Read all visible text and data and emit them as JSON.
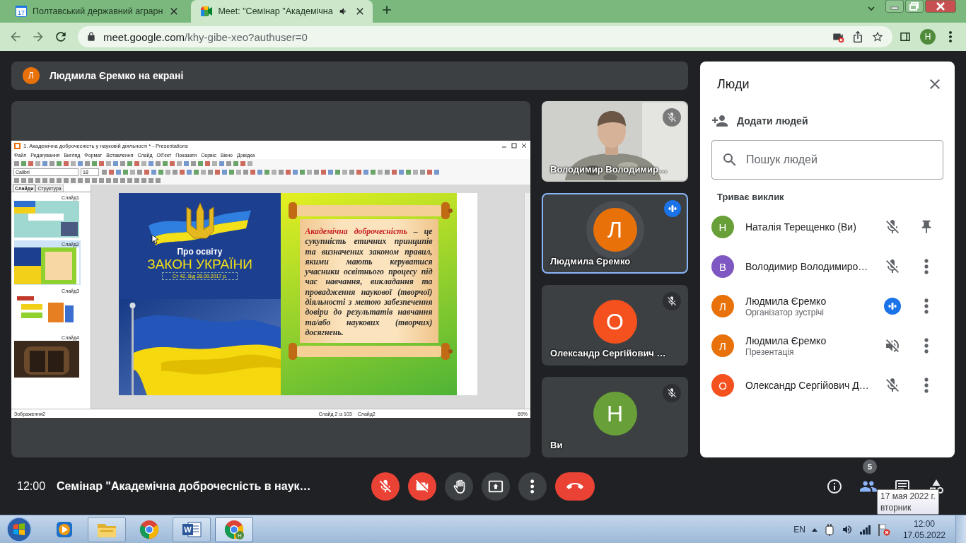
{
  "browser": {
    "tabs": [
      {
        "title": "Полтавський державний аграрн",
        "kind": "calendar",
        "icon_text": "17",
        "selected": false,
        "audio": false
      },
      {
        "title": "Meet: \"Семінар \"Академічна",
        "kind": "meet",
        "selected": true,
        "audio": true
      }
    ],
    "address": {
      "host": "meet.google.com",
      "path": "/khy-gibe-xeo?authuser=0"
    },
    "profile_initial": "Н"
  },
  "presenter_banner": {
    "initial": "Л",
    "text": "Людмила Єремко на екрані"
  },
  "shared_screen": {
    "window_title": "1. Академічна доброчесність у науковій діяльності * - Presentations",
    "menu": [
      "Файл",
      "Редагування",
      "Вигляд",
      "Формат",
      "Вставлення",
      "Слайд",
      "Об'єкт",
      "Показати",
      "Сервіс",
      "Вікно",
      "Довідка"
    ],
    "font_name": "Calibri",
    "font_size": "18",
    "panel_tabs": [
      {
        "label": "Слайди",
        "selected": true
      },
      {
        "label": "Структура",
        "selected": false
      }
    ],
    "thumbnails": [
      {
        "label": "Слайд1",
        "selected": false
      },
      {
        "label": "Слайд2",
        "selected": true
      },
      {
        "label": "Слайд3",
        "selected": false
      },
      {
        "label": "Слайд4",
        "selected": false
      }
    ],
    "slide": {
      "subtitle": "Про освіту",
      "title": "ЗАКОН УКРАЇНИ",
      "caption": "Ст 42. Від 28.09.2017 р.",
      "definition": "**Академічна доброчесність** – це сукупність етичних принципів та визначених законом правил, якими мають керуватися учасники освітнього процесу під час навчання, викладання та провадження наукової (творчої) діяльності з метою забезпечення довіри до результатів навчання та/або наукових (творчих) досягнень."
    },
    "status": {
      "object": "Зображення2",
      "position": "Слайд 2 із 103",
      "slide_name": "Слайд2",
      "zoom": "69%"
    }
  },
  "tiles": [
    {
      "kind": "video",
      "name": "Володимир Володимир…",
      "muted": true,
      "speaking": false
    },
    {
      "kind": "avatar",
      "initial": "Л",
      "color": "#e8710a",
      "name": "Людмила Єремко",
      "muted": false,
      "speaking": true
    },
    {
      "kind": "avatar",
      "initial": "О",
      "color": "#f4511e",
      "name": "Олександр Сергійович …",
      "muted": true,
      "speaking": false
    },
    {
      "kind": "avatar",
      "initial": "Н",
      "color": "#689f38",
      "name": "Ви",
      "muted": true,
      "speaking": false
    }
  ],
  "people": {
    "title": "Люди",
    "add_label": "Додати людей",
    "search_placeholder": "Пошук людей",
    "section": "Триває виклик",
    "participants": [
      {
        "kind": "self",
        "initial": "Н",
        "color": "#689f38",
        "name": "Наталія Терещенко (Ви)",
        "muted": true,
        "speaking": false,
        "sound_off": false
      },
      {
        "kind": "other",
        "initial": "В",
        "color": "#7e57c2",
        "name": "Володимир Володимиро…",
        "muted": true,
        "speaking": false,
        "sound_off": false
      },
      {
        "kind": "other",
        "initial": "Л",
        "color": "#e8710a",
        "name": "Людмила Єремко",
        "role": "Організатор зустрічі",
        "muted": false,
        "speaking": true,
        "sound_off": false
      },
      {
        "kind": "other",
        "initial": "Л",
        "color": "#e8710a",
        "name": "Людмила Єремко",
        "role": "Презентація",
        "muted": false,
        "speaking": false,
        "sound_off": true
      },
      {
        "kind": "other",
        "initial": "О",
        "color": "#f4511e",
        "name": "Олександр Сергійович Д…",
        "muted": true,
        "speaking": false,
        "sound_off": false
      }
    ]
  },
  "controls": {
    "time": "12:00",
    "meeting_title": "Семінар \"Академічна доброчесність в наук…",
    "buttons": [
      {
        "kind": "mic",
        "on": false
      },
      {
        "kind": "camera",
        "on": false
      },
      {
        "kind": "hand"
      },
      {
        "kind": "present"
      },
      {
        "kind": "more"
      },
      {
        "kind": "leave"
      }
    ],
    "side": [
      {
        "kind": "info",
        "selected": false
      },
      {
        "kind": "people",
        "badge": "5",
        "selected": true
      },
      {
        "kind": "chat",
        "selected": false
      },
      {
        "kind": "activities",
        "selected": false
      }
    ]
  },
  "tooltip": {
    "date": "17 мая 2022 г.",
    "weekday": "вторник"
  },
  "taskbar": {
    "apps": [
      {
        "kind": "media",
        "running": false,
        "selected": false
      },
      {
        "kind": "folder",
        "running": true,
        "selected": false
      },
      {
        "kind": "browser",
        "running": false,
        "selected": false
      },
      {
        "kind": "word",
        "badge": "W",
        "running": true,
        "selected": false
      },
      {
        "kind": "browser",
        "badge": "Н",
        "running": true,
        "selected": true
      }
    ],
    "language": "EN",
    "time": "12:00",
    "date": "17.05.2022"
  }
}
